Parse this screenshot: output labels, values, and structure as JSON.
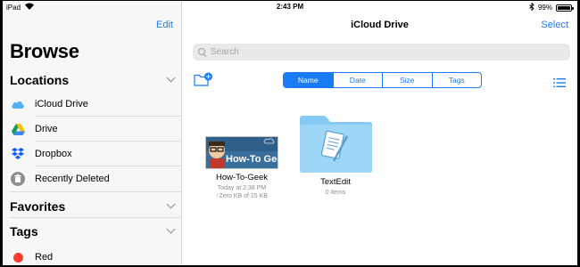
{
  "status": {
    "device": "iPad",
    "time": "2:43 PM",
    "battery": "99%",
    "battery_level": 0.99
  },
  "sidebar": {
    "edit_label": "Edit",
    "title": "Browse",
    "locations": {
      "heading": "Locations",
      "items": [
        {
          "label": "iCloud Drive",
          "icon": "icloud-icon"
        },
        {
          "label": "Drive",
          "icon": "google-drive-icon"
        },
        {
          "label": "Dropbox",
          "icon": "dropbox-icon"
        },
        {
          "label": "Recently Deleted",
          "icon": "trash-icon"
        }
      ]
    },
    "favorites": {
      "heading": "Favorites"
    },
    "tags": {
      "heading": "Tags",
      "items": [
        {
          "label": "Red",
          "color": "#ff3b30"
        }
      ]
    }
  },
  "main": {
    "title": "iCloud Drive",
    "select_label": "Select",
    "search": {
      "placeholder": "Search"
    },
    "sort_tabs": [
      {
        "label": "Name",
        "active": true
      },
      {
        "label": "Date",
        "active": false
      },
      {
        "label": "Size",
        "active": false
      },
      {
        "label": "Tags",
        "active": false
      }
    ],
    "files": [
      {
        "name": "How-To-Geek",
        "meta1": "Today at 2:38 PM",
        "meta2": "↑Zero KB of 15 KB",
        "thumb_text": "How-To Geek"
      },
      {
        "name": "TextEdit",
        "meta1": "0 items"
      }
    ]
  },
  "colors": {
    "accent": "#1a7cf5",
    "folder": "#7ec8f3",
    "sidebar_bg": "#f7f7f7"
  }
}
